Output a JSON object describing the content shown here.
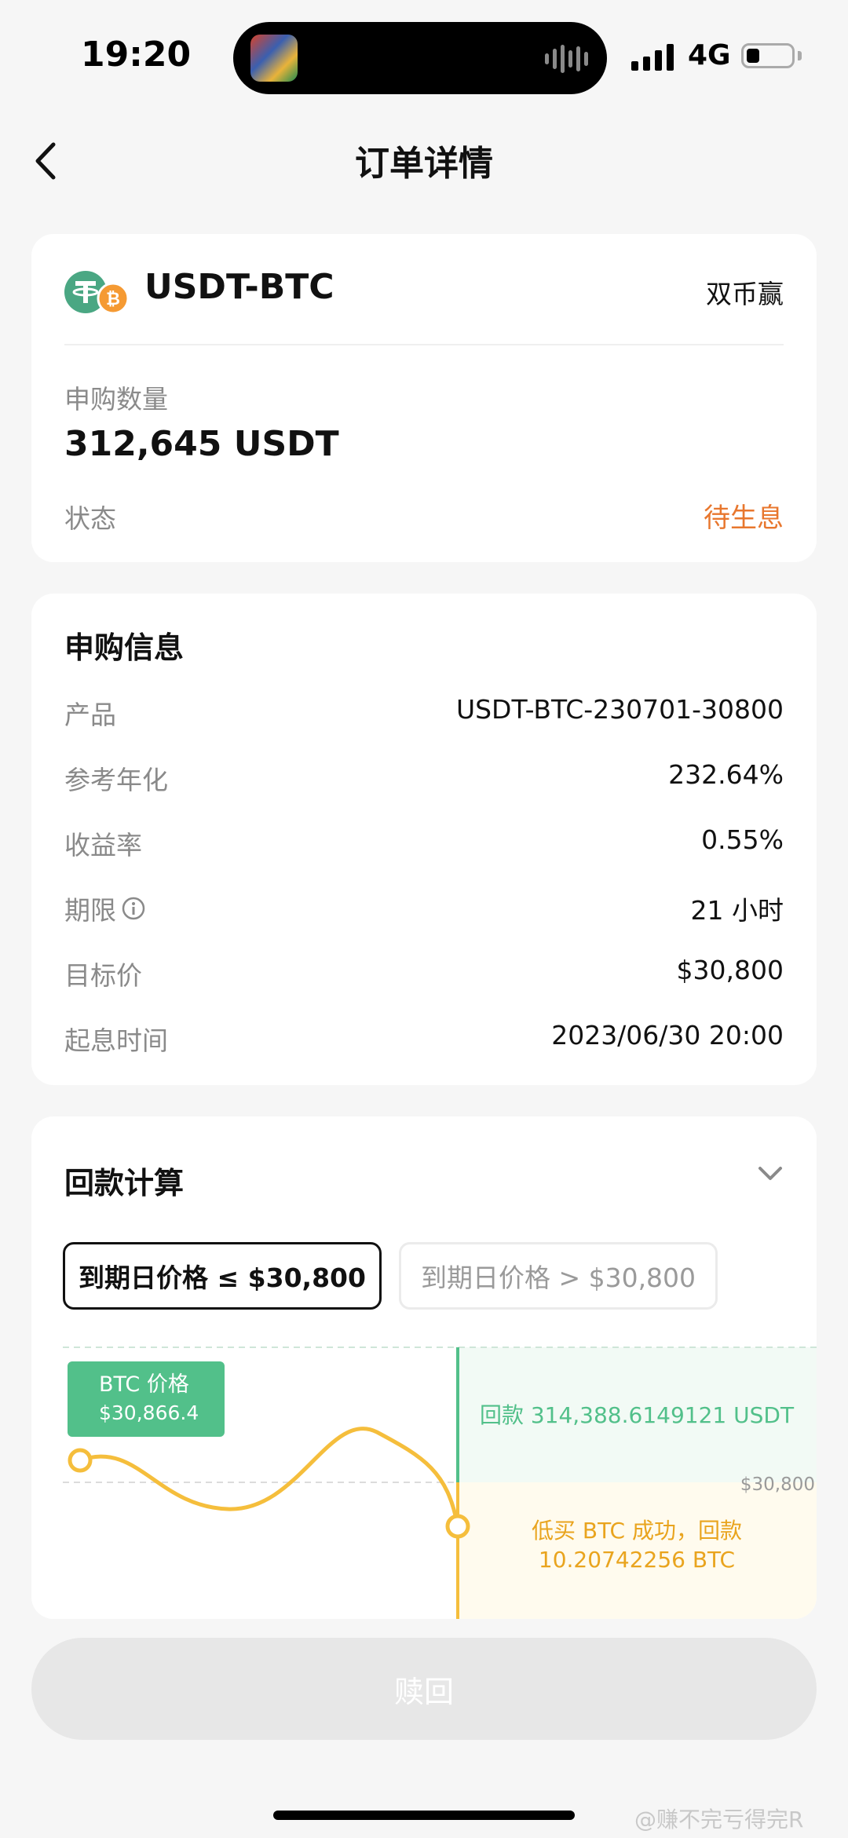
{
  "status_bar": {
    "time": "19:20",
    "network": "4G",
    "icons": [
      "signal-icon",
      "battery-icon"
    ]
  },
  "header": {
    "title": "订单详情",
    "back_icon": "chevron-left-icon"
  },
  "summary": {
    "pair": "USDT-BTC",
    "product_type": "双币赢",
    "quantity_label": "申购数量",
    "quantity_value": "312,645 USDT",
    "status_label": "状态",
    "status_value": "待生息",
    "status_color": "#e8772e",
    "icons": [
      "usdt-coin-icon",
      "btc-coin-icon"
    ]
  },
  "subscription": {
    "title": "申购信息",
    "rows": [
      {
        "label": "产品",
        "value": "USDT-BTC-230701-30800"
      },
      {
        "label": "参考年化",
        "value": "232.64%"
      },
      {
        "label": "收益率",
        "value": "0.55%"
      },
      {
        "label": "期限",
        "value": "21 小时"
      },
      {
        "label": "目标价",
        "value": "$30,800"
      },
      {
        "label": "起息时间",
        "value": "2023/06/30 20:00"
      }
    ]
  },
  "payout": {
    "title": "回款计算",
    "tabs": [
      {
        "label": "到期日价格 ≤ $30,800",
        "active": true
      },
      {
        "label": "到期日价格 > $30,800",
        "active": false
      }
    ],
    "chart": {
      "tooltip_line1": "BTC 价格",
      "tooltip_line2": "$30,866.4",
      "upper_text": "回款 314,388.6149121 USDT",
      "strike_label": "$30,800",
      "lower_text_line1": "低买 BTC 成功，回款",
      "lower_text_line2": "10.20742256 BTC",
      "colors": {
        "green": "#52c08a",
        "yellow": "#f5be3c",
        "orange_text": "#e9a41e"
      }
    }
  },
  "footer": {
    "redeem_label": "赎回",
    "watermark": "@赚不完亏得完R"
  }
}
